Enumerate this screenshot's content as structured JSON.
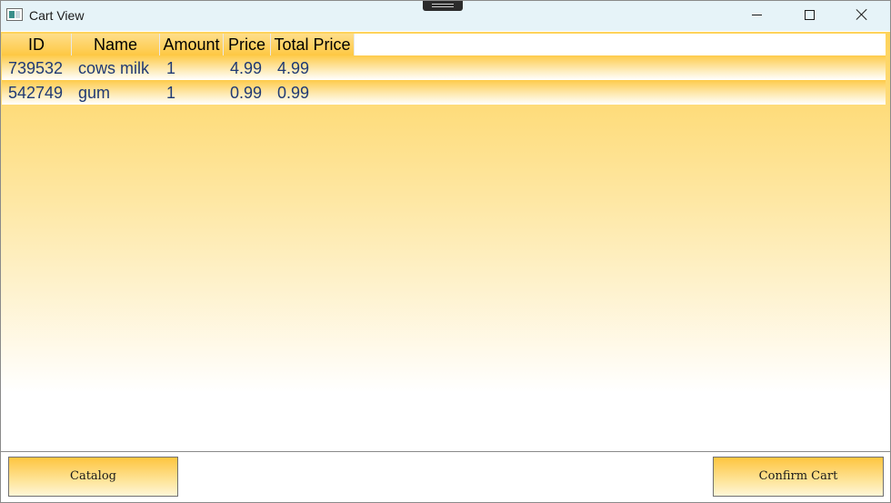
{
  "window": {
    "title": "Cart View",
    "icon": "app-window-icon",
    "controls": [
      "minimize-icon",
      "maximize-icon",
      "close-icon"
    ]
  },
  "grid": {
    "columns": [
      "ID",
      "Name",
      "Amount",
      "Price",
      "Total Price"
    ],
    "rows": [
      {
        "id": "739532",
        "name": "cows milk",
        "amount": "1",
        "price": "4.99",
        "total": "4.99"
      },
      {
        "id": "542749",
        "name": "gum",
        "amount": "1",
        "price": "0.99",
        "total": "0.99"
      }
    ]
  },
  "footer": {
    "catalog_label": "Catalog",
    "confirm_label": "Confirm Cart"
  },
  "colors": {
    "accent_gold": "#fed35a",
    "cell_text": "#1f3a74",
    "titlebar": "#e6f3f8"
  }
}
